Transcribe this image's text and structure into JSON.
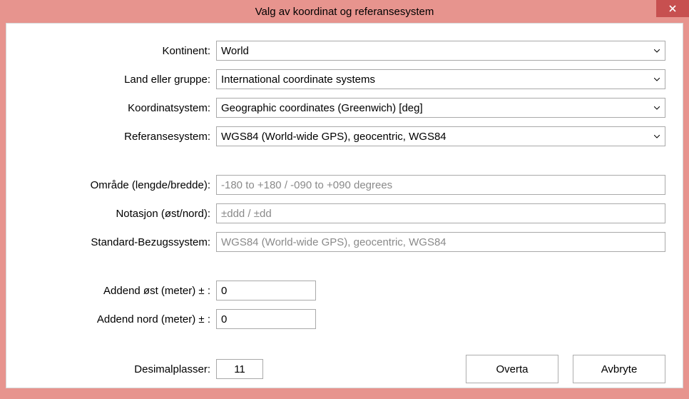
{
  "window": {
    "title": "Valg av koordinat og referansesystem"
  },
  "labels": {
    "continent": "Kontinent:",
    "country_group": "Land eller gruppe:",
    "coord_system": "Koordinatsystem:",
    "ref_system": "Referansesystem:",
    "area": "Område (lengde/bredde):",
    "notation": "Notasjon (øst/nord):",
    "std_ref": "Standard-Bezugssystem:",
    "addend_east": "Addend øst (meter) ± :",
    "addend_north": "Addend nord (meter) ± :",
    "decimals": "Desimalplasser:"
  },
  "values": {
    "continent": "World",
    "country_group": "International coordinate systems",
    "coord_system": "Geographic coordinates (Greenwich) [deg]",
    "ref_system": "WGS84 (World-wide GPS), geocentric, WGS84",
    "area": "-180 to +180 / -090 to +090 degrees",
    "notation": "±ddd / ±dd",
    "std_ref": "WGS84 (World-wide GPS), geocentric, WGS84",
    "addend_east": "0",
    "addend_north": "0",
    "decimals": "11"
  },
  "buttons": {
    "apply": "Overta",
    "cancel": "Avbryte"
  }
}
